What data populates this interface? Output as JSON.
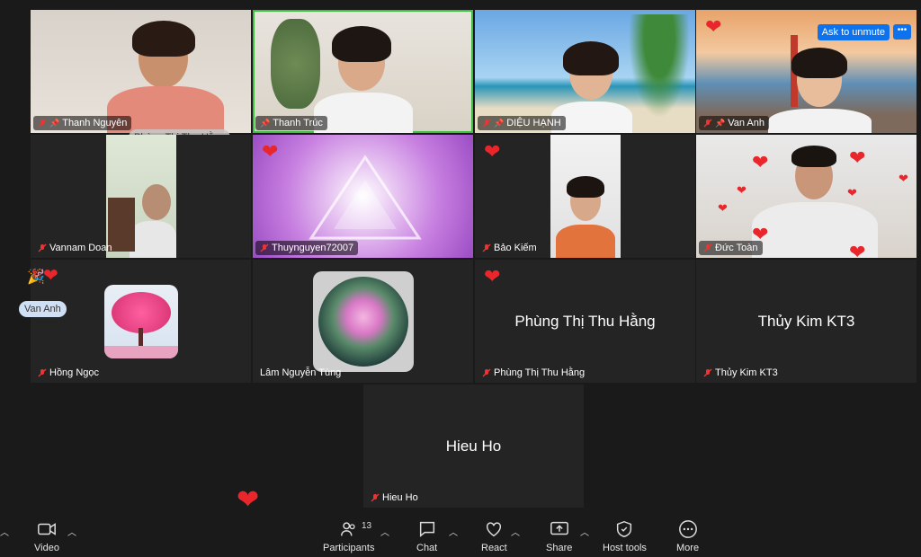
{
  "participants_tiles": [
    {
      "name": "Thanh Nguyên"
    },
    {
      "name": "Thanh Trúc"
    },
    {
      "name": "DIỆU HẠNH"
    },
    {
      "name": "Van Anh"
    },
    {
      "name": "Vannam Doan"
    },
    {
      "name": "Thuynguyen72007"
    },
    {
      "name": "Bảo Kiếm"
    },
    {
      "name": "Đức Toàn"
    },
    {
      "name": "Hồng Ngọc"
    },
    {
      "name": "Lâm Nguyễn Tùng"
    },
    {
      "name": "Phùng Thị Thu Hằng",
      "display_name": "Phùng Thị Thu Hằng"
    },
    {
      "name": "Thủy Kim KT3",
      "display_name": "Thủy Kim KT3"
    },
    {
      "name": "Hieu Ho",
      "display_name": "Hieu Ho"
    }
  ],
  "overlay_name": "Phùng Thị Thu Hằng",
  "ask_to_unmute": "Ask to unmute",
  "more_dots": "•••",
  "reaction_badge": "Van Anh",
  "toolbar": {
    "video": "Video",
    "participants": "Participants",
    "participants_count": "13",
    "chat": "Chat",
    "react": "React",
    "share": "Share",
    "host_tools": "Host tools",
    "more": "More"
  },
  "colors": {
    "accent": "#0e72ed",
    "speaking": "#3fbf3f",
    "heart": "#e8262b"
  }
}
